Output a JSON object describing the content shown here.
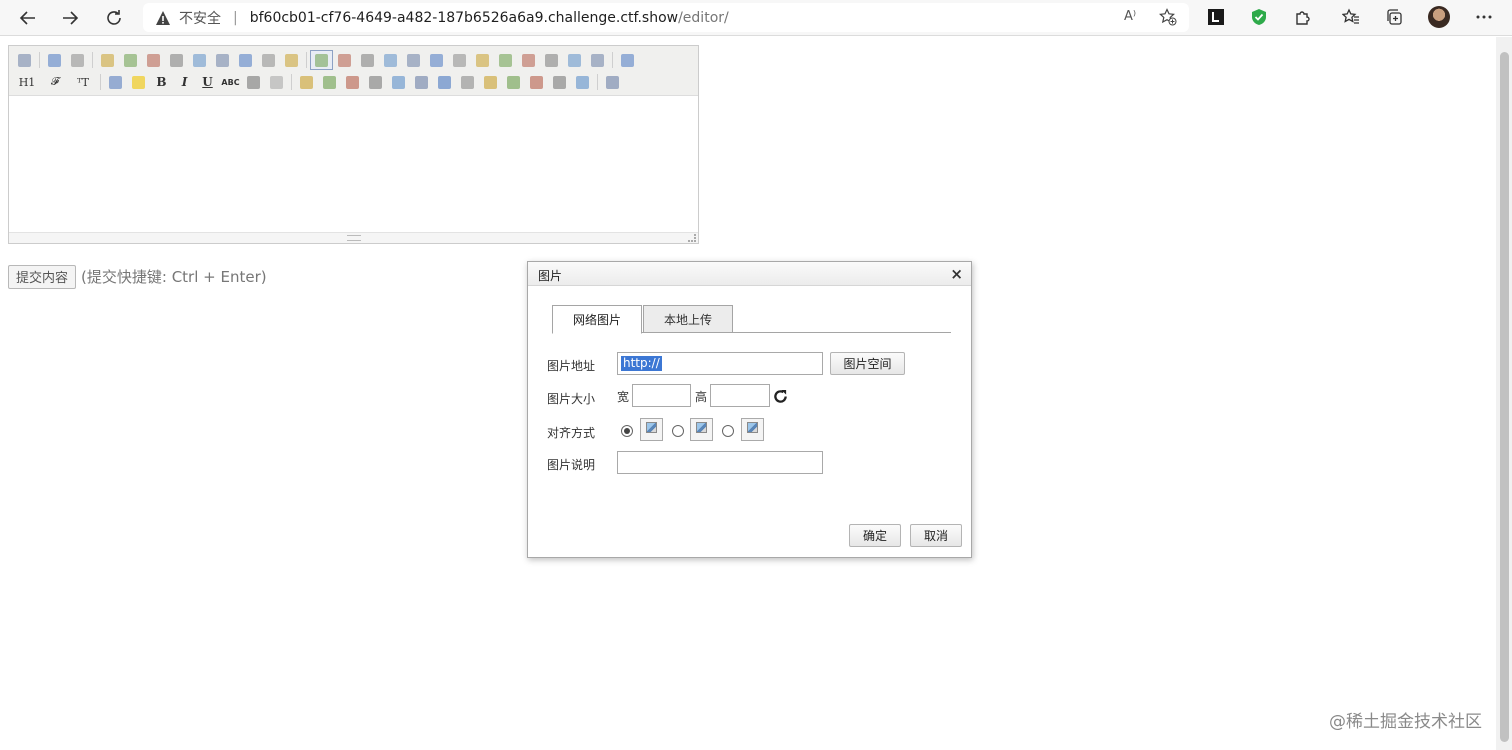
{
  "browser": {
    "security_label": "不安全",
    "url_host": "bf60cb01-cf76-4649-a482-187b6526a6a9.challenge.ctf.show",
    "url_path": "/editor/",
    "read_aloud_label": "A⁾",
    "icons": [
      "back-icon",
      "forward-icon",
      "refresh-icon",
      "warning-icon",
      "read-aloud-icon",
      "add-favorite-icon",
      "extension-l-icon",
      "shield-check-icon",
      "extensions-icon",
      "favorites-icon",
      "collections-icon",
      "profile-avatar",
      "more-icon"
    ]
  },
  "editor": {
    "toolbar_row1": [
      "source-icon",
      "undo-icon",
      "redo-icon",
      "preview-icon",
      "print-icon",
      "template-icon",
      "code-icon",
      "cut-icon",
      "copy-icon",
      "paste-icon",
      "paste-plain-icon",
      "paste-word-icon",
      "align-left-icon",
      "align-center-icon",
      "align-right-icon",
      "justify-icon",
      "ordered-list-icon",
      "unordered-list-icon",
      "indent-icon",
      "outdent-icon",
      "subscript-icon",
      "superscript-icon",
      "clear-html-icon",
      "quick-format-icon",
      "select-all-icon",
      "fullscreen-icon"
    ],
    "toolbar_row2_labels": {
      "heading": "H1",
      "font_name": "𝓕",
      "font_size": "ᵀT",
      "bold": "B",
      "italic": "I",
      "underline": "U",
      "strikethrough": "ABC"
    },
    "toolbar_row2": [
      "forecolor-icon",
      "hilitecolor-icon",
      "line-height-icon",
      "remove-format-icon",
      "image-icon",
      "multi-image-icon",
      "flash-icon",
      "media-icon",
      "insert-file-icon",
      "table-icon",
      "hr-icon",
      "emoticons-icon",
      "baidu-map-icon",
      "pagebreak-icon",
      "anchor-icon",
      "link-icon",
      "unlink-icon",
      "about-icon"
    ]
  },
  "submit": {
    "button_label": "提交内容",
    "hint": "(提交快捷键: Ctrl + Enter)"
  },
  "dialog": {
    "title": "图片",
    "close_label": "×",
    "tabs": [
      {
        "label": "网络图片",
        "active": true
      },
      {
        "label": "本地上传",
        "active": false
      }
    ],
    "fields": {
      "url_label": "图片地址",
      "url_value": "http://",
      "browse_button": "图片空间",
      "size_label": "图片大小",
      "width_label": "宽",
      "height_label": "高",
      "width_value": "",
      "height_value": "",
      "align_label": "对齐方式",
      "align_selected": "default",
      "caption_label": "图片说明",
      "caption_value": ""
    },
    "ok_button": "确定",
    "cancel_button": "取消"
  },
  "watermark": "@稀土掘金技术社区",
  "colors": {
    "selection": "#3c77d4",
    "shield_green": "#2eaa4a",
    "toolbar_bg": "#f0f0ee"
  }
}
